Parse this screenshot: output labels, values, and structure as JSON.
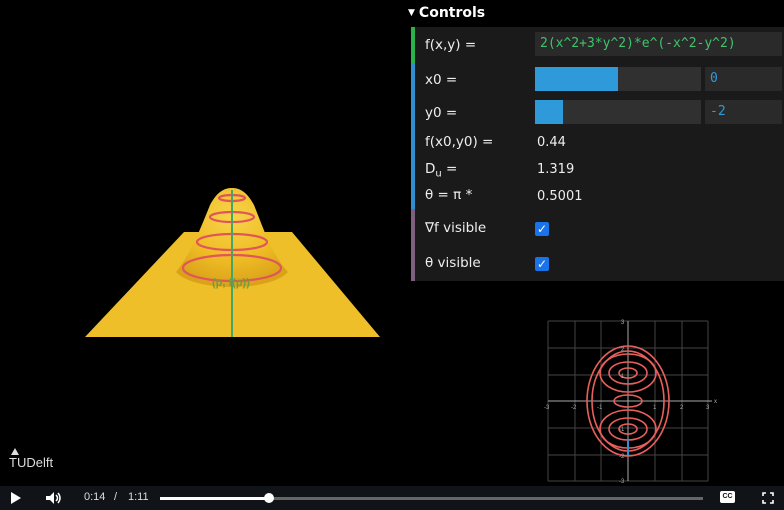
{
  "controls": {
    "title": "Controls",
    "fxy_label": "f(x,y) =",
    "fxy_value": "2(x^2+3*y^2)*e^(-x^2-y^2)",
    "x0_label": "x0 =",
    "x0_value": "0",
    "x0_level": 0.5,
    "y0_label": "y0 =",
    "y0_value": "-2",
    "y0_level": 0.17,
    "fx0y0_label": "f(x0,y0) =",
    "fx0y0_value": "0.44",
    "du_label": "D",
    "du_sub": "u",
    "du_eq": " =",
    "du_value": "1.319",
    "theta_label": "θ = π *",
    "theta_value": "0.5001",
    "grad_label": "∇f visible",
    "grad_checked": true,
    "theta_vis_label": "θ visible",
    "theta_vis_checked": true,
    "colors": {
      "fxy_bar": "#2bb24c",
      "slider_bar": "#2f8fcf",
      "vis_bar": "#7d5f7e",
      "formula_text": "#3ec46b",
      "slider_fill": "#2f9ad9"
    }
  },
  "surface": {
    "point_label": "(p, f(p))",
    "surface_color": "#f2c12e",
    "contour_color": "#e0555a"
  },
  "contour_plot": {
    "x_ticks": [
      "-3",
      "-2",
      "-1",
      "1",
      "2",
      "3"
    ],
    "y_ticks": [
      "3",
      "2",
      "1",
      "-1",
      "-2",
      "-3"
    ],
    "x_axis_label": "x"
  },
  "logo": {
    "text": "TUDelft"
  },
  "video": {
    "current_time": "0:14",
    "separator": "/",
    "duration": "1:11",
    "progress": 0.2,
    "cc_label": "CC",
    "play_icon": "play-icon",
    "volume_icon": "volume-icon",
    "fullscreen_icon": "fullscreen-icon"
  }
}
